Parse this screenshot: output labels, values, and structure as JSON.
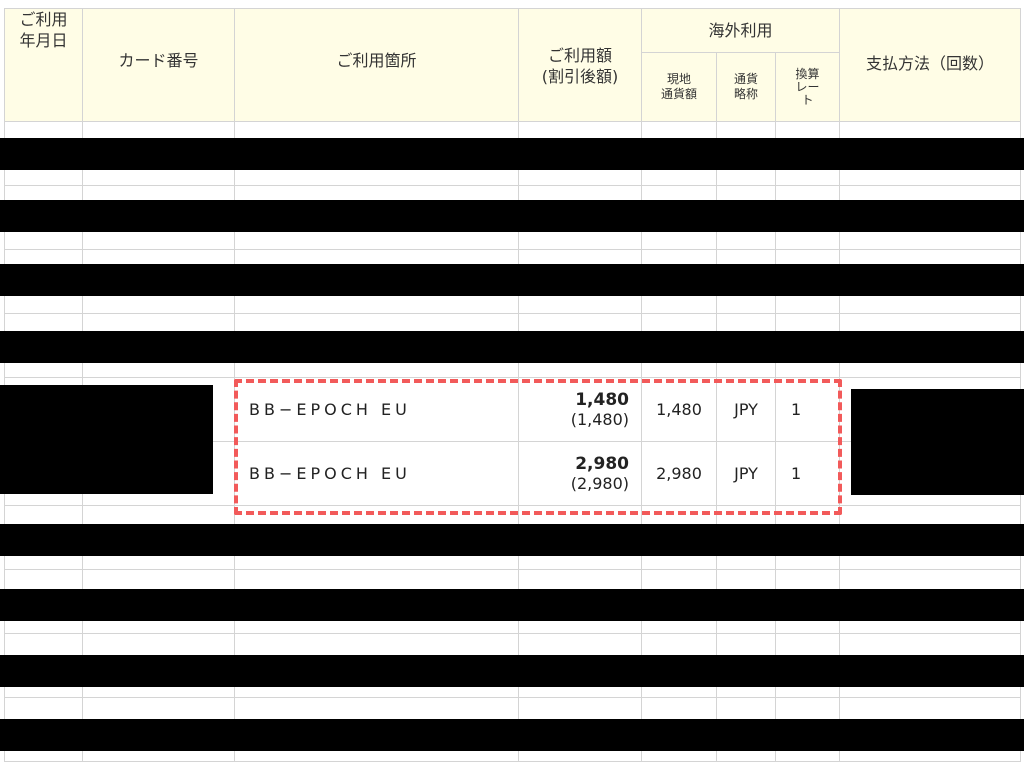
{
  "headers": {
    "date": "ご利用\n年月日",
    "card_number": "カード番号",
    "merchant": "ご利用箇所",
    "amount": "ご利用額\n(割引後額)",
    "overseas": "海外利用",
    "local_amount": "現地\n通貨額",
    "currency": "通貨\n略称",
    "rate": "換算\nレー\nト",
    "payment_method": "支払方法（回数）"
  },
  "rows": [
    {
      "merchant": "",
      "amount": "",
      "amount_discounted": "",
      "local_amount": "",
      "currency": "",
      "rate": ""
    },
    {
      "merchant": "",
      "amount": "",
      "amount_discounted": "",
      "local_amount": "",
      "currency": "",
      "rate": ""
    },
    {
      "merchant": "",
      "amount": "",
      "amount_discounted": "",
      "local_amount": "",
      "currency": "",
      "rate": ""
    },
    {
      "merchant": "",
      "amount": "",
      "amount_discounted": "",
      "local_amount": "",
      "currency": "",
      "rate": ""
    },
    {
      "merchant": "BB−EPOCH EU",
      "amount": "1,480",
      "amount_discounted": "(1,480)",
      "local_amount": "1,480",
      "currency": "JPY",
      "rate": "1"
    },
    {
      "merchant": "BB−EPOCH EU",
      "amount": "2,980",
      "amount_discounted": "(2,980)",
      "local_amount": "2,980",
      "currency": "JPY",
      "rate": "1"
    },
    {
      "merchant": "",
      "amount": "",
      "amount_discounted": "",
      "local_amount": "",
      "currency": "",
      "rate": ""
    },
    {
      "merchant": "",
      "amount": "",
      "amount_discounted": "",
      "local_amount": "",
      "currency": "",
      "rate": ""
    },
    {
      "merchant": "",
      "amount": "",
      "amount_discounted": "",
      "local_amount": "",
      "currency": "",
      "rate": ""
    },
    {
      "merchant": "",
      "amount": "",
      "amount_discounted": "",
      "local_amount": "",
      "currency": "",
      "rate": ""
    }
  ],
  "colors": {
    "header_bg": "#fffde6",
    "border": "#d4d4d4",
    "highlight": "#f25a5a",
    "redaction": "#000000"
  }
}
